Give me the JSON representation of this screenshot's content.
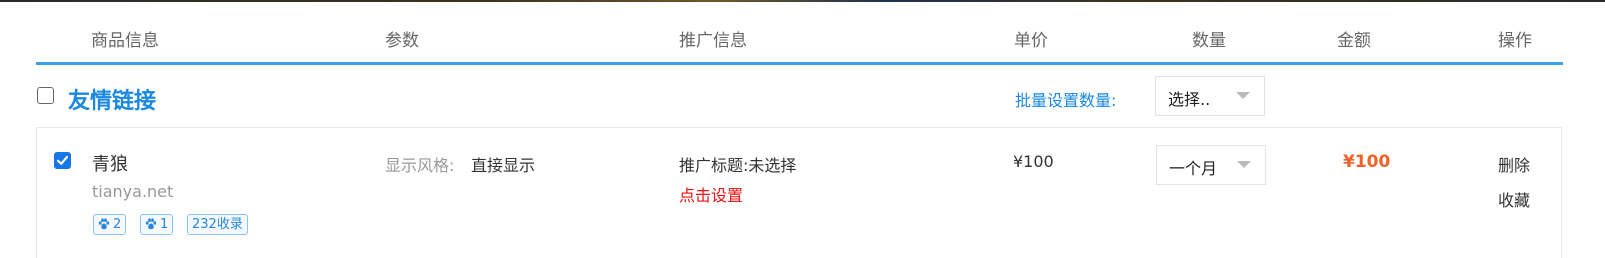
{
  "header": {
    "columns": [
      "商品信息",
      "参数",
      "推广信息",
      "单价",
      "数量",
      "金额",
      "操作"
    ]
  },
  "group": {
    "checked": false,
    "title": "友情链接",
    "batch_label": "批量设置数量:",
    "batch_select": "选择.."
  },
  "items": [
    {
      "checked": true,
      "name": "青狼",
      "domain": "tianya.net",
      "tags": [
        {
          "icon": "paw-icon",
          "text": "2"
        },
        {
          "icon": "paw-icon",
          "text": "1"
        },
        {
          "icon": "",
          "text": "232收录"
        }
      ],
      "param_label": "显示风格:",
      "param_value": "直接显示",
      "promo_title": "推广标题:未选择",
      "promo_link": "点击设置",
      "price": "¥100",
      "quantity": "一个月",
      "amount": "¥100",
      "actions": [
        "删除",
        "收藏"
      ]
    }
  ],
  "colors": {
    "accent": "#3aa1ea",
    "link_blue": "#1a88e0",
    "amount": "#f0622a",
    "warn_red": "#ee1111"
  }
}
